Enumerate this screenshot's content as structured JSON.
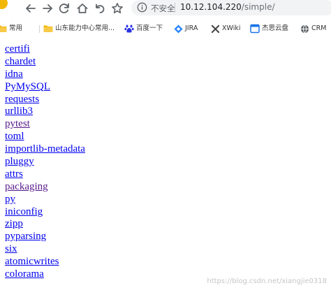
{
  "toolbar": {
    "omnibox": {
      "security_label": "不安全",
      "url_host": "10.12.104.220",
      "url_path": "/simple/"
    }
  },
  "bookmarks": [
    {
      "label": "常用",
      "icon": "folder-icon",
      "color": "#f2b705"
    },
    {
      "label": "山东能力中心常用...",
      "icon": "folder-icon",
      "color": "#f2b705"
    },
    {
      "label": "百度一下",
      "icon": "baidu-paw-icon",
      "color": "#2932e1"
    },
    {
      "label": "JIRA",
      "icon": "jira-icon",
      "color": "#2684ff"
    },
    {
      "label": "XWiki",
      "icon": "xwiki-icon",
      "color": "#444444"
    },
    {
      "label": "杰思云盘",
      "icon": "cloud-drive-icon",
      "color": "#1a73e8"
    },
    {
      "label": "CRM",
      "icon": "globe-icon",
      "color": "#5f6368"
    }
  ],
  "packages": [
    {
      "name": "certifi",
      "visited": false
    },
    {
      "name": "chardet",
      "visited": false
    },
    {
      "name": "idna",
      "visited": false
    },
    {
      "name": "PyMySQL",
      "visited": false
    },
    {
      "name": "requests",
      "visited": false
    },
    {
      "name": "urllib3",
      "visited": false
    },
    {
      "name": "pytest",
      "visited": true
    },
    {
      "name": "toml",
      "visited": false
    },
    {
      "name": "importlib-metadata",
      "visited": false
    },
    {
      "name": "pluggy",
      "visited": false
    },
    {
      "name": "attrs",
      "visited": false
    },
    {
      "name": "packaging",
      "visited": true
    },
    {
      "name": "py",
      "visited": false
    },
    {
      "name": "iniconfig",
      "visited": false
    },
    {
      "name": "zipp",
      "visited": false
    },
    {
      "name": "pyparsing",
      "visited": false
    },
    {
      "name": "six",
      "visited": false
    },
    {
      "name": "atomicwrites",
      "visited": false
    },
    {
      "name": "colorama",
      "visited": false
    }
  ],
  "watermark": "https://blog.csdn.net/xiangjie0318",
  "colors": {
    "link": "#0000ee",
    "link_visited": "#551a8b",
    "omnibox_bg": "#f1f3f4"
  }
}
